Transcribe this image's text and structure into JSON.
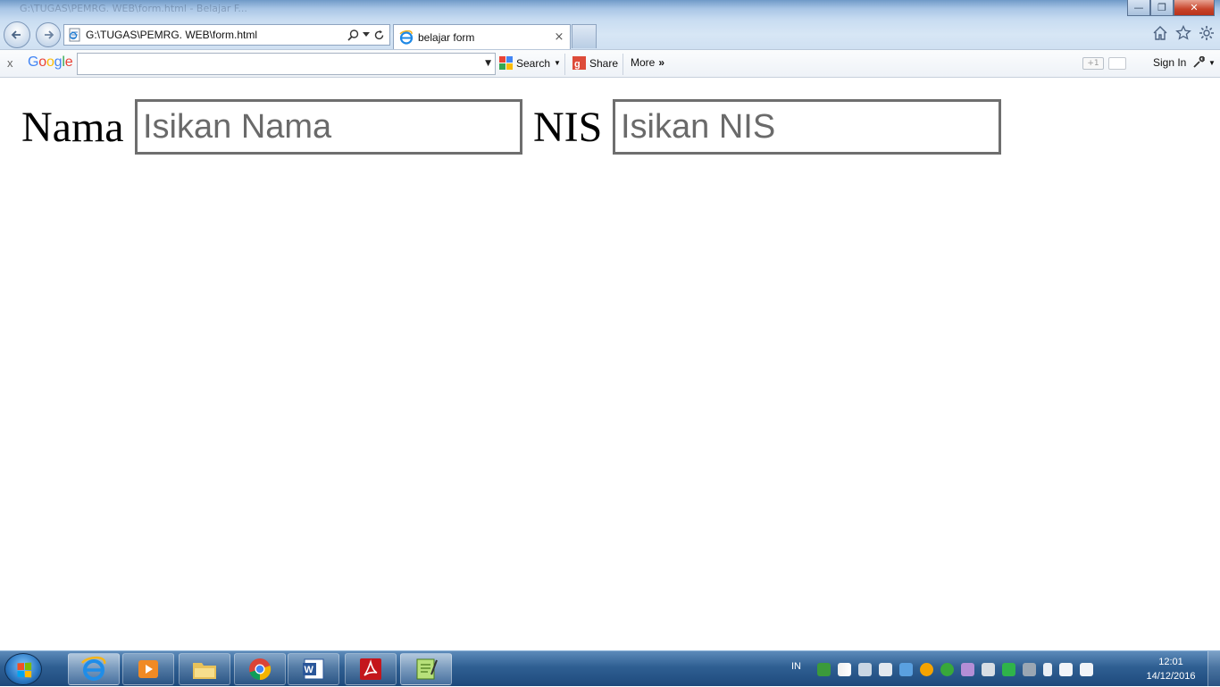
{
  "window": {
    "ghost_title": "G:\\TUGAS\\PEMRG. WEB\\form.html - Belajar F...",
    "controls": {
      "minimize": "—",
      "maximize": "❐",
      "close": "✕"
    }
  },
  "address_bar": {
    "url": "G:\\TUGAS\\PEMRG. WEB\\form.html"
  },
  "tab": {
    "title": "belajar form",
    "close": "×"
  },
  "google_toolbar": {
    "close": "x",
    "logo": {
      "G": "G",
      "o1": "o",
      "o2": "o",
      "g": "g",
      "l": "l",
      "e": "e"
    },
    "search_value": "",
    "search_label": "Search",
    "share_label": "Share",
    "more_label": "More",
    "gplus_label": "+1",
    "signin_label": "Sign In"
  },
  "form": {
    "nama_label": "Nama",
    "nama_placeholder": "Isikan Nama",
    "nis_label": "NIS",
    "nis_placeholder": "Isikan NIS"
  },
  "taskbar": {
    "language": "IN",
    "time": "12:01",
    "date": "14/12/2016"
  }
}
